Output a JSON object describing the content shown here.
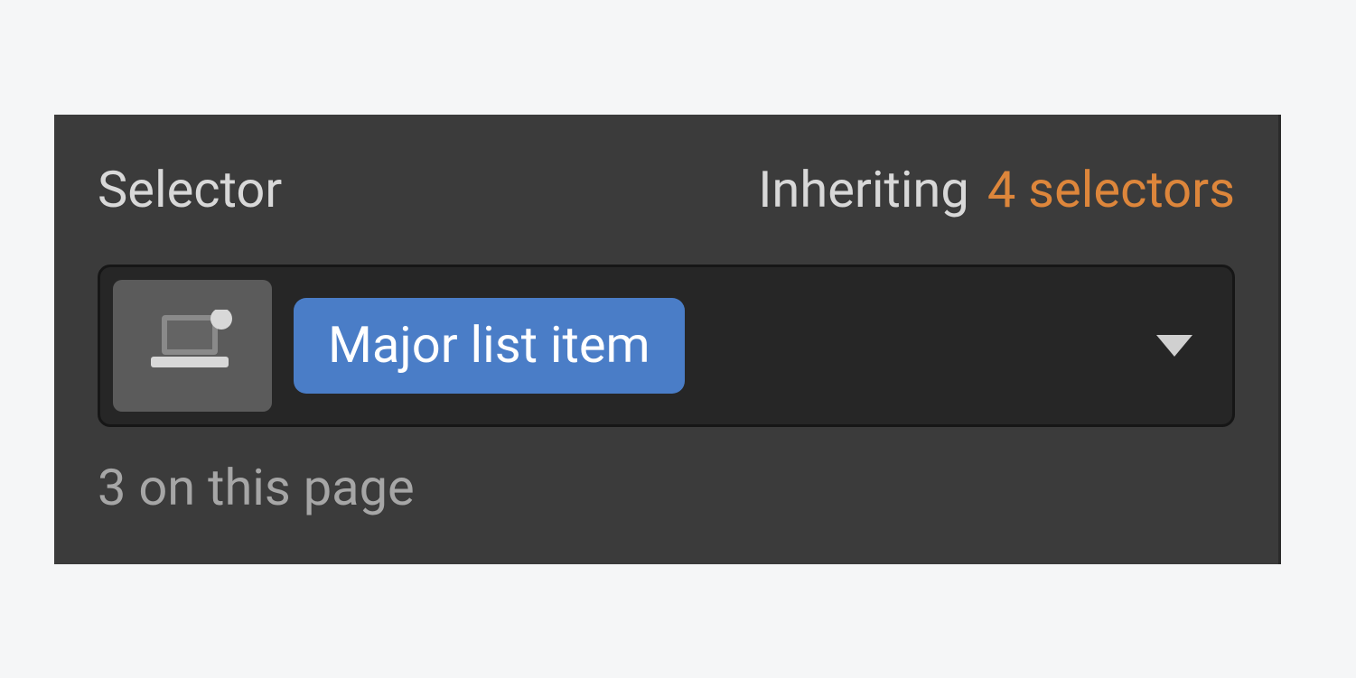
{
  "selector_panel": {
    "label": "Selector",
    "inheriting_label": "Inheriting",
    "inheriting_count_text": "4 selectors",
    "class_name": "Major list item",
    "footer_count_text": "3 on this page"
  }
}
